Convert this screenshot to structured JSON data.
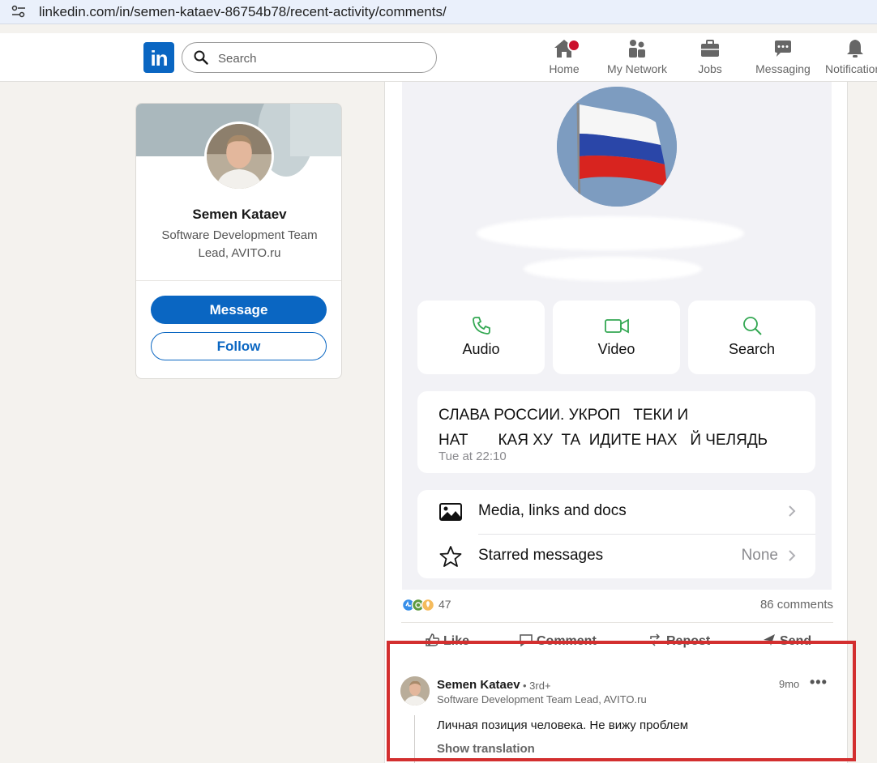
{
  "browser": {
    "url": "linkedin.com/in/semen-kataev-86754b78/recent-activity/comments/"
  },
  "nav": {
    "logo": "in",
    "search_placeholder": "Search",
    "items": [
      {
        "label": "Home",
        "icon": "home-icon"
      },
      {
        "label": "My Network",
        "icon": "network-icon"
      },
      {
        "label": "Jobs",
        "icon": "briefcase-icon"
      },
      {
        "label": "Messaging",
        "icon": "chat-icon"
      },
      {
        "label": "Notifications",
        "icon": "bell-icon"
      }
    ]
  },
  "profile": {
    "name": "Semen Kataev",
    "headline": "Software Development Team Lead, AVITO.ru",
    "message_label": "Message",
    "follow_label": "Follow"
  },
  "post": {
    "screenshot": {
      "tiles": [
        {
          "label": "Audio",
          "icon": "phone-icon"
        },
        {
          "label": "Video",
          "icon": "video-icon"
        },
        {
          "label": "Search",
          "icon": "search-icon"
        }
      ],
      "message_line1": "СЛАВА РОССИИ. УКРОП   ТЕКИ И",
      "message_line2": "НАТ       КАЯ ХУ  ТА  ИДИТЕ НАХ   Й ЧЕЛЯДЬ",
      "message_time": "Tue at 22:10",
      "media_label": "Media, links and docs",
      "starred_label": "Starred messages",
      "starred_value": "None"
    },
    "reactions_count": "47",
    "comments_count": "86 comments",
    "actions": {
      "like": "Like",
      "comment": "Comment",
      "repost": "Repost",
      "send": "Send"
    }
  },
  "comment": {
    "author": "Semen Kataev",
    "degree": "• 3rd+",
    "headline": "Software Development Team Lead, AVITO.ru",
    "time": "9mo",
    "more": "•••",
    "text": "Личная позиция человека. Не вижу проблем",
    "show_translation": "Show translation"
  },
  "colors": {
    "brand": "#0a66c2",
    "highlight_box": "#d32f2f",
    "badge": "#cb112d"
  }
}
